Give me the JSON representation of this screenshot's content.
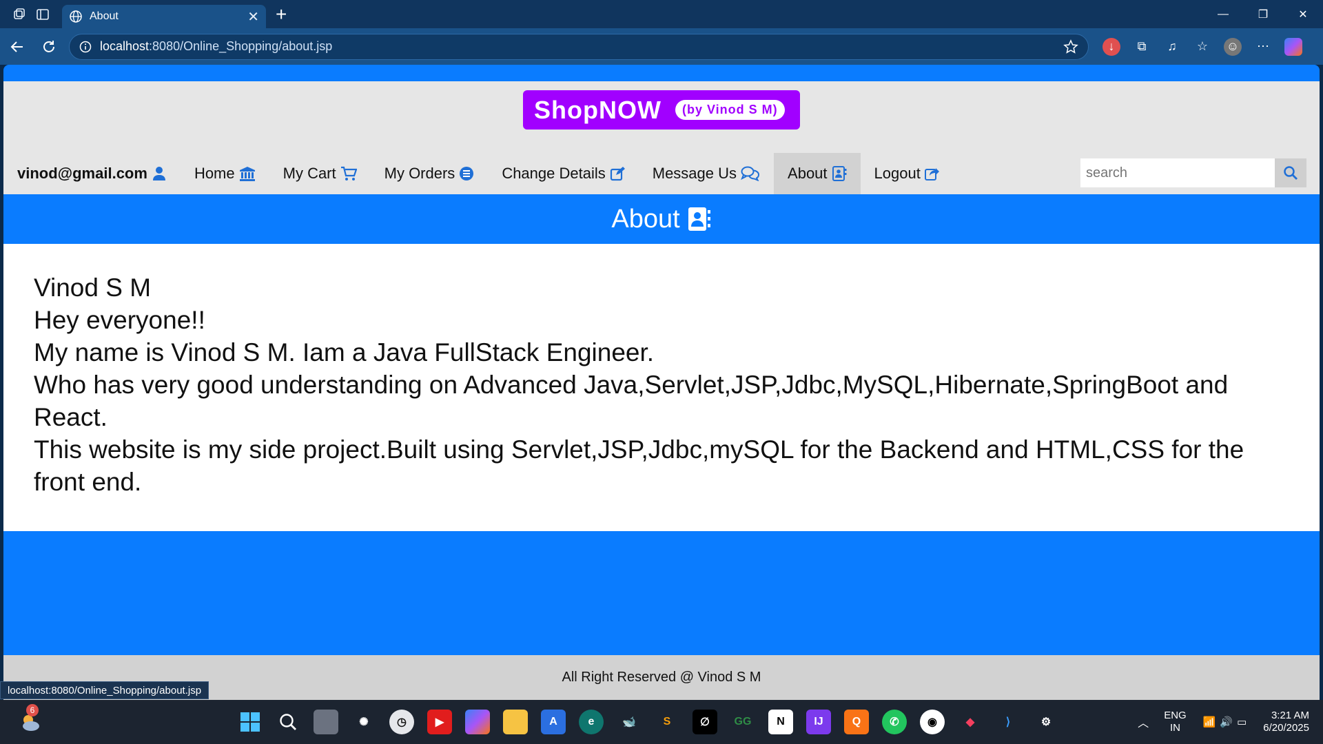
{
  "browser": {
    "tab_title": "About",
    "url_host": "localhost",
    "url_rest": ":8080/Online_Shopping/about.jsp",
    "status_url": "localhost:8080/Online_Shopping/about.jsp"
  },
  "site": {
    "logo_main": "ShopNOW",
    "logo_by": "(by Vinod S M)",
    "user_email": "vinod@gmail.com",
    "menu": [
      {
        "label": "Home",
        "icon": "bank-icon"
      },
      {
        "label": "My Cart",
        "icon": "cart-icon"
      },
      {
        "label": "My Orders",
        "icon": "list-circle-icon"
      },
      {
        "label": "Change Details",
        "icon": "edit-icon"
      },
      {
        "label": "Message Us",
        "icon": "chat-icon"
      },
      {
        "label": "About",
        "icon": "contact-card-icon",
        "active": true
      },
      {
        "label": "Logout",
        "icon": "share-out-icon"
      }
    ],
    "search_placeholder": "search",
    "page_heading": "About",
    "about_lines": [
      "Vinod S M",
      "Hey everyone!!",
      "My name is Vinod S M. Iam a Java FullStack Engineer.",
      "Who has very good understanding on Advanced Java,Servlet,JSP,Jdbc,MySQL,Hibernate,SpringBoot and React.",
      "This website is my side project.Built using Servlet,JSP,Jdbc,mySQL for the Backend and HTML,CSS for the front end."
    ],
    "footer": "All Right Reserved @ Vinod S M"
  },
  "taskbar": {
    "weather_badge": "6",
    "lang_line1": "ENG",
    "lang_line2": "IN",
    "time": "3:21 AM",
    "date": "6/20/2025"
  },
  "colors": {
    "primary": "#0a7cff",
    "brand": "#a100ff",
    "header_bg": "#e6e6e6"
  }
}
